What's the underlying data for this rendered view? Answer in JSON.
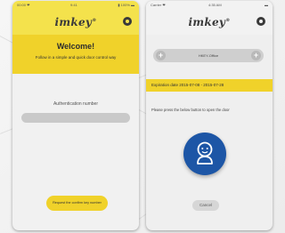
{
  "left_screen": {
    "status_carrier": "00:00 ❤",
    "status_time": "9:41",
    "status_battery": "▮ 100% ▬",
    "logo": "imkey",
    "logo_mark": "®",
    "welcome_title": "Welcome!",
    "welcome_subtitle": "Follow in a simple and quick door control way",
    "auth_label": "Authentication number",
    "auth_value": "",
    "bind_button": "Request the confirm key number"
  },
  "right_screen": {
    "status_carrier": "Carrier ❤",
    "status_time": "4:35 AM",
    "status_battery": "▬",
    "logo": "imkey",
    "logo_mark": "®",
    "device_name": "HKEY-Office",
    "prev_label": "+",
    "next_label": "+",
    "expiration": "Expiration date 2015-07-08 - 2015-07-28",
    "hint": "Please press the below button to open the door",
    "cancel_button": "Cancel"
  },
  "icons": {
    "settings": "gear-icon",
    "unlock": "person-icon"
  },
  "colors": {
    "brand_yellow": "#f0d22a",
    "unlock_blue": "#1d56a6"
  }
}
